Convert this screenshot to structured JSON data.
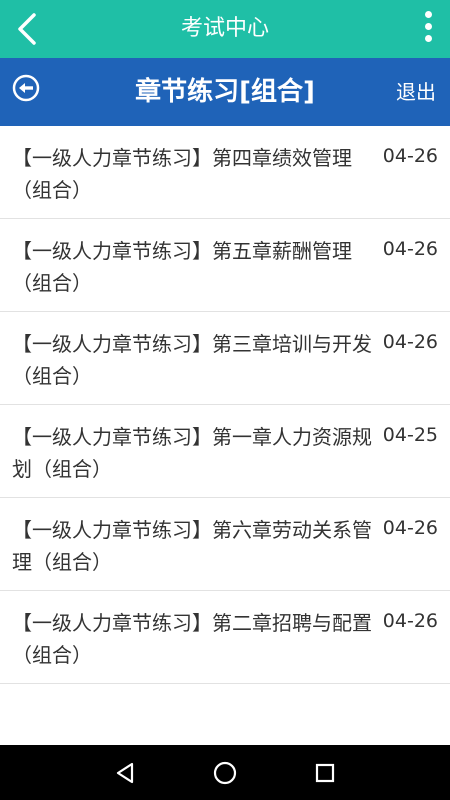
{
  "appbar": {
    "title": "考试中心",
    "back_icon": "chevron-left-icon",
    "menu_icon": "more-vertical-icon",
    "color": "#1fbfa6"
  },
  "subbar": {
    "title": "章节练习[组合]",
    "exit_label": "退出",
    "back_icon": "circle-arrow-left-icon",
    "color": "#1f63b8"
  },
  "items": [
    {
      "title": "【一级人力章节练习】第四章绩效管理（组合）",
      "date": "04-26"
    },
    {
      "title": "【一级人力章节练习】第五章薪酬管理（组合）",
      "date": "04-26"
    },
    {
      "title": "【一级人力章节练习】第三章培训与开发（组合）",
      "date": "04-26"
    },
    {
      "title": "【一级人力章节练习】第一章人力资源规划（组合）",
      "date": "04-25"
    },
    {
      "title": "【一级人力章节练习】第六章劳动关系管理（组合）",
      "date": "04-26"
    },
    {
      "title": "【一级人力章节练习】第二章招聘与配置（组合）",
      "date": "04-26"
    }
  ],
  "navbar": {
    "back_icon": "triangle-back-icon",
    "home_icon": "circle-home-icon",
    "recents_icon": "square-recents-icon"
  }
}
